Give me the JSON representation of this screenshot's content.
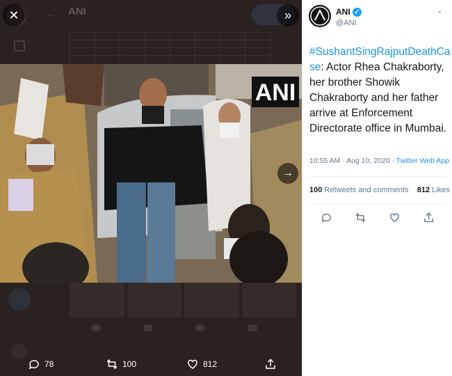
{
  "viewer": {
    "bg_name": "ANI",
    "actions": {
      "replies": "78",
      "retweets": "100",
      "likes": "812"
    }
  },
  "photo": {
    "watermark": "ANI"
  },
  "tweet": {
    "author_name": "ANI",
    "handle": "@ANI",
    "hashtag": "#SushantSingRajputDeathCase",
    "body": ": Actor Rhea Chakraborty, her brother Showik Chakraborty and her father arrive at Enforcement Directorate office in Mumbai.",
    "timestamp": "10:55 AM · Aug 10, 2020 · ",
    "source": "Twitter Web App",
    "retweets_count": "100",
    "retweets_label": "Retweets and comments",
    "likes_count": "812",
    "likes_label": "Likes"
  },
  "colors": {
    "accent": "#1b95e0",
    "verified": "#1da1f2",
    "viewer_bg": "#2a2220"
  },
  "icons": [
    "close-icon",
    "expand-icon",
    "next-arrow-icon",
    "reply-icon",
    "retweet-icon",
    "like-icon",
    "share-icon",
    "verified-icon",
    "chevron-down-icon"
  ]
}
